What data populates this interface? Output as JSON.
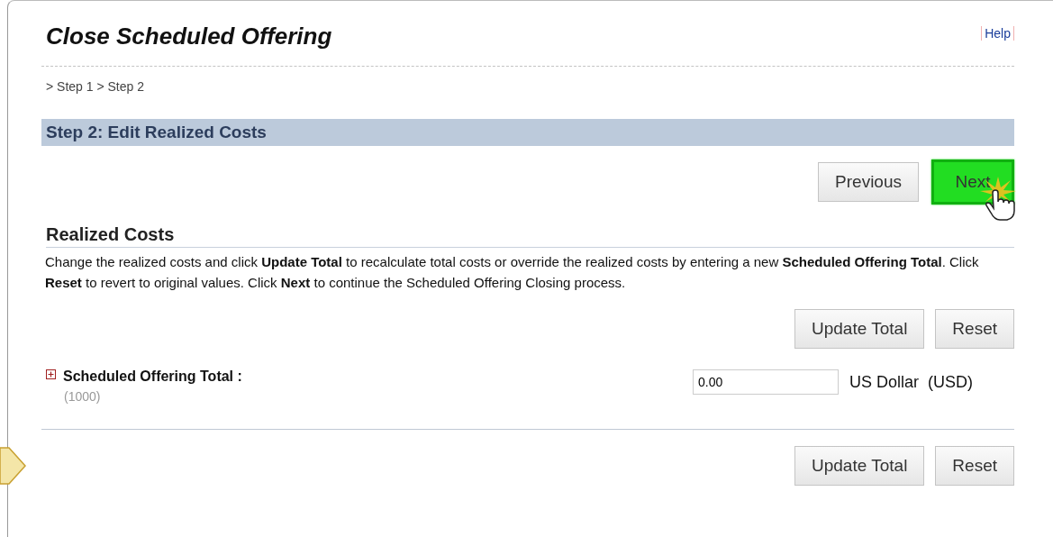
{
  "title": "Close Scheduled Offering",
  "help_link": "Help",
  "breadcrumb": "> Step 1 > Step 2",
  "step_header": "Step 2: Edit Realized Costs",
  "nav_buttons": [
    {
      "label": "Previous",
      "highlighted": false
    },
    {
      "label": "Next",
      "highlighted": true
    }
  ],
  "section": {
    "title": "Realized Costs",
    "description": "Change the realized costs and click **Update Total** to recalculate total costs or override the realized costs by entering a new **Scheduled Offering Total**. Click **Reset** to revert to original values. Click **Next** to continue the Scheduled Offering Closing process."
  },
  "top_actions": [
    "Update Total",
    "Reset"
  ],
  "total": {
    "label": "Scheduled Offering Total :",
    "code": "(1000)",
    "expanded": false,
    "value": "0.00",
    "currency": "US Dollar  (USD)"
  },
  "bottom_actions": [
    "Update Total",
    "Reset"
  ]
}
